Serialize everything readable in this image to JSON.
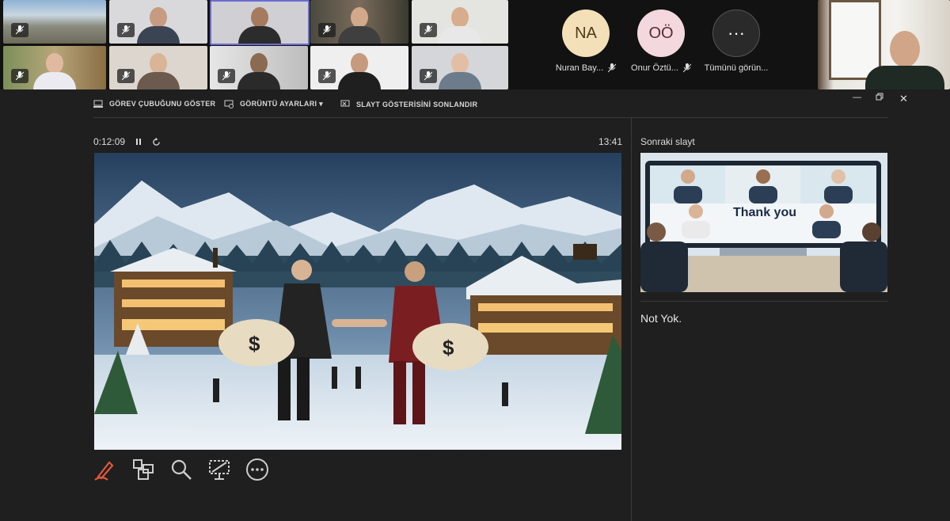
{
  "participants_avatars": [
    {
      "initials": "NA",
      "name": "Nuran Bay...",
      "bg": "#f3e0b8"
    },
    {
      "initials": "OÖ",
      "name": "Onur Öztü...",
      "bg": "#f3d8dd"
    }
  ],
  "more_button": {
    "icon": "ellipsis-icon",
    "label": "Tümünü görün..."
  },
  "toolbar": {
    "show_taskbar": "GÖREV ÇUBUĞUNU GÖSTER",
    "display_settings": "GÖRÜNTÜ AYARLARI ▾",
    "end_slideshow": "SLAYT GÖSTERİSİNİ SONLANDIR"
  },
  "timer": {
    "elapsed": "0:12:09",
    "clock": "13:41"
  },
  "next_slide": {
    "label": "Sonraki slayt",
    "thank_you": "Thank you"
  },
  "notes": {
    "text": "Not Yok."
  },
  "colors": {
    "background": "#1f1f1f",
    "accent_pen": "#e0583a"
  }
}
